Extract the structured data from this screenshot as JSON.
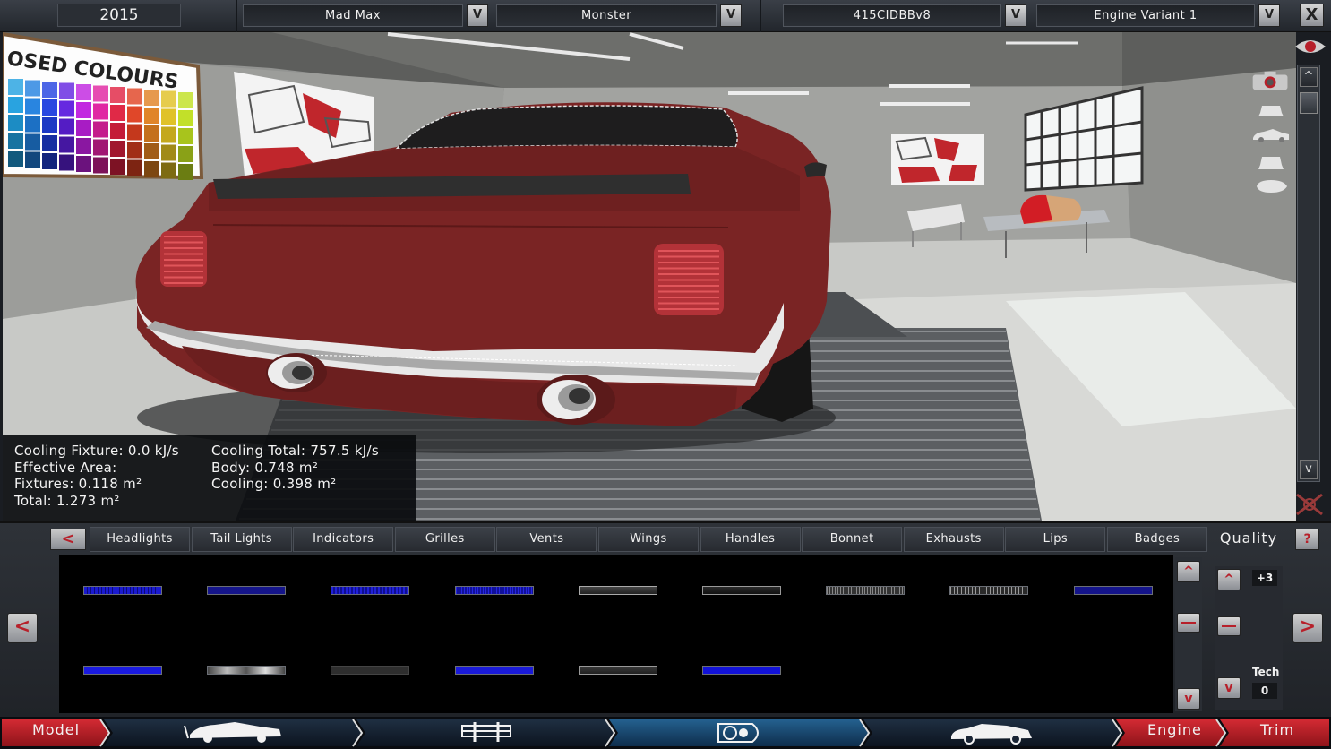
{
  "topbar": {
    "year": "2015",
    "dropdowns": [
      {
        "label": "Mad Max"
      },
      {
        "label": "Monster"
      },
      {
        "label": "415CIDBBv8"
      },
      {
        "label": "Engine Variant 1"
      }
    ],
    "dropdown_arrow": "V",
    "close_label": "X"
  },
  "viewport": {
    "poster_text": "OSED COLOURS"
  },
  "stats": {
    "cooling_fixture": "Cooling Fixture: 0.0 kJ/s",
    "effective_area": "Effective Area:",
    "fixtures": "Fixtures: 0.118 m²",
    "total": "Total: 1.273 m²",
    "cooling_total": "Cooling Total: 757.5 kJ/s",
    "body": "Body: 0.748 m²",
    "cooling": "Cooling: 0.398 m²"
  },
  "camera_scroll": {
    "up": "^",
    "down": "v"
  },
  "tabs": {
    "prev": "<",
    "items": [
      "Headlights",
      "Tail Lights",
      "Indicators",
      "Grilles",
      "Vents",
      "Wings",
      "Handles",
      "Bonnet",
      "Exhausts",
      "Lips",
      "Badges"
    ],
    "quality": "Quality",
    "help": "?"
  },
  "grid": {
    "prev": "<",
    "next": ">",
    "scroll_up": "^",
    "scroll_down": "v"
  },
  "quality_panel": {
    "up": "^",
    "down": "v",
    "quality_value": "+3",
    "tech_label": "Tech",
    "tech_value": "0"
  },
  "nav": {
    "model": "Model",
    "engine": "Engine",
    "trim": "Trim"
  },
  "colors": {
    "accent_red": "#b7202a",
    "nav_active": "#1d4f7c",
    "car_body": "#7a2424"
  }
}
